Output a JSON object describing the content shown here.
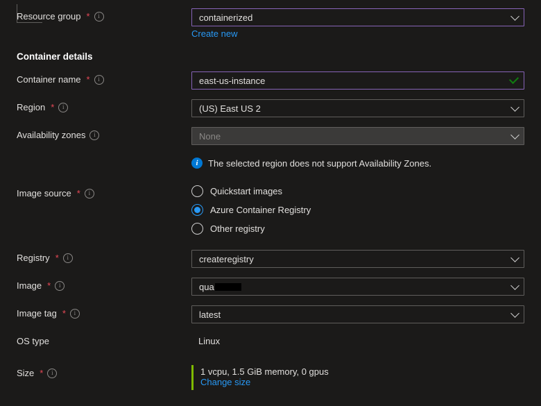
{
  "resource_group": {
    "label": "Resource group",
    "value": "containerized",
    "create_new": "Create new"
  },
  "section_container_details": "Container details",
  "container_name": {
    "label": "Container name",
    "value": "east-us-instance"
  },
  "region": {
    "label": "Region",
    "value": "(US) East US 2"
  },
  "availability_zones": {
    "label": "Availability zones",
    "value": "None"
  },
  "az_info": "The selected region does not support Availability Zones.",
  "image_source": {
    "label": "Image source",
    "option_quickstart": "Quickstart images",
    "option_acr": "Azure Container Registry",
    "option_other": "Other registry"
  },
  "registry": {
    "label": "Registry",
    "value": "createregistry"
  },
  "image": {
    "label": "Image",
    "value": "qua"
  },
  "image_tag": {
    "label": "Image tag",
    "value": "latest"
  },
  "os_type": {
    "label": "OS type",
    "value": "Linux"
  },
  "size": {
    "label": "Size",
    "value": "1 vcpu, 1.5 GiB memory, 0 gpus",
    "change": "Change size"
  }
}
